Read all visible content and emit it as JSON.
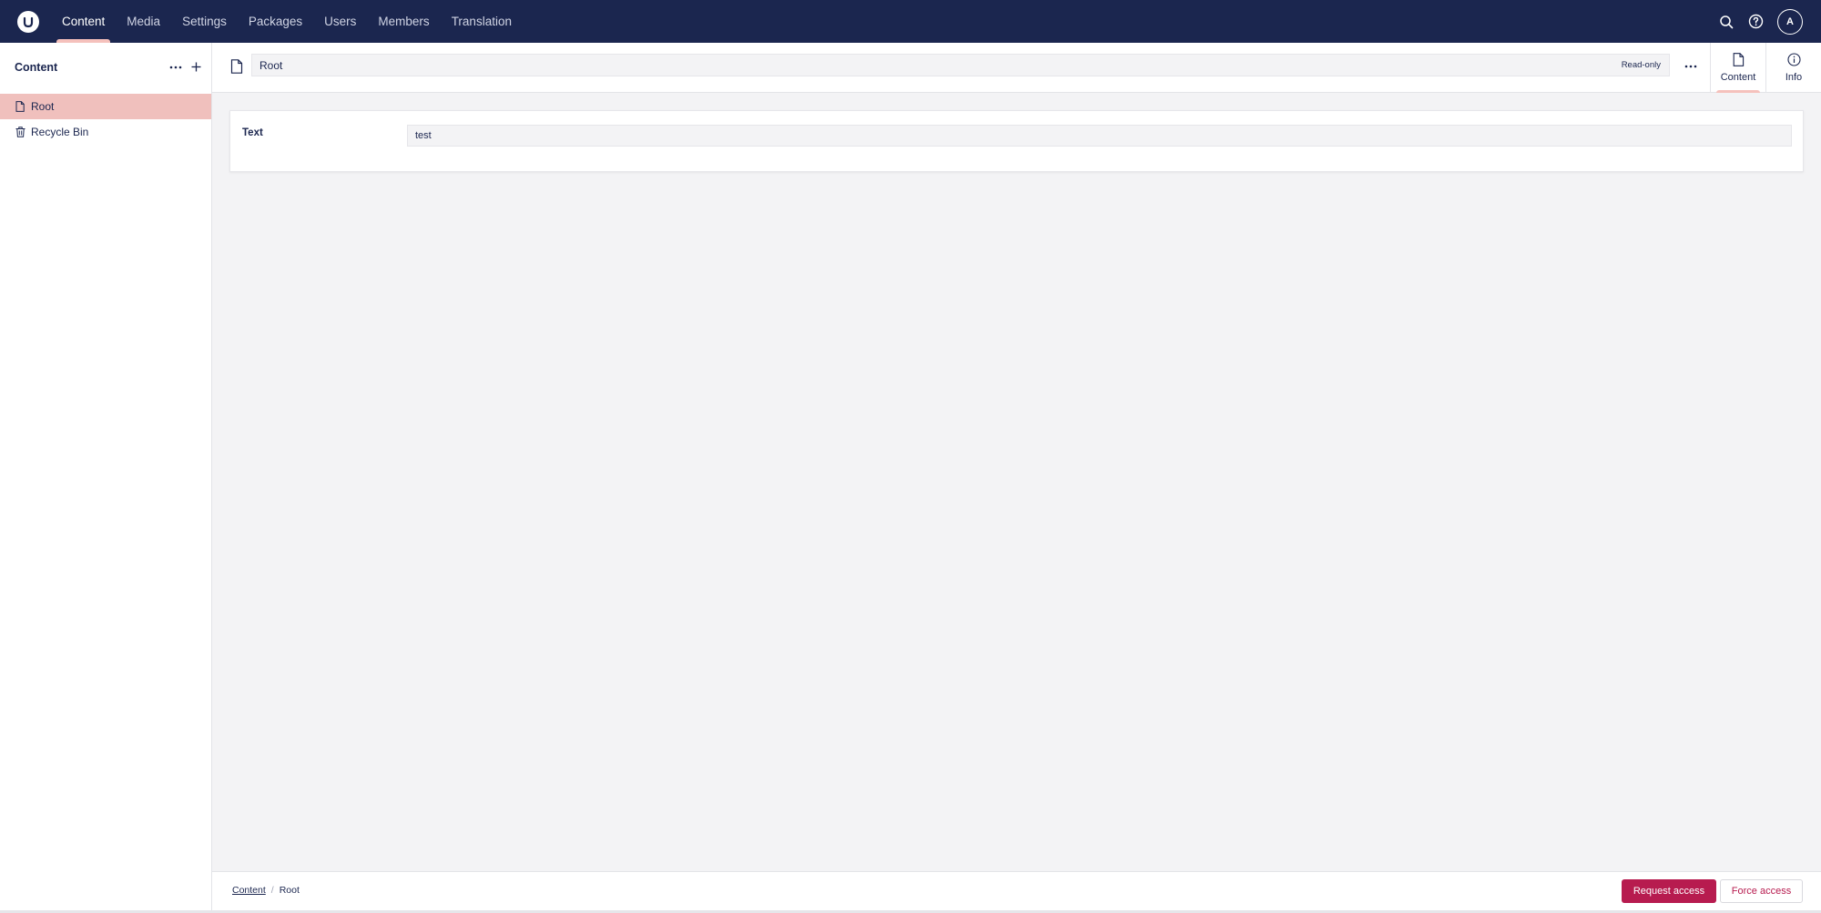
{
  "header": {
    "sections": [
      {
        "label": "Content"
      },
      {
        "label": "Media"
      },
      {
        "label": "Settings"
      },
      {
        "label": "Packages"
      },
      {
        "label": "Users"
      },
      {
        "label": "Members"
      },
      {
        "label": "Translation"
      }
    ],
    "active_section": "Content",
    "search_icon": "search-icon",
    "help_icon": "help-icon",
    "avatar_initial": "A"
  },
  "sidebar": {
    "title": "Content",
    "items": [
      {
        "label": "Root",
        "icon": "document-icon",
        "selected": true
      },
      {
        "label": "Recycle Bin",
        "icon": "trash-icon",
        "selected": false
      }
    ]
  },
  "editor": {
    "node_name": "Root",
    "status_badge": "Read-only",
    "views": [
      {
        "label": "Content",
        "icon": "document-icon",
        "active": true
      },
      {
        "label": "Info",
        "icon": "info-icon",
        "active": false
      }
    ],
    "properties": [
      {
        "label": "Text",
        "value": "test"
      }
    ]
  },
  "footer": {
    "breadcrumb": [
      {
        "label": "Content"
      },
      {
        "label": "Root"
      }
    ],
    "request_access_label": "Request access",
    "force_access_label": "Force access"
  },
  "colors": {
    "header_bg": "#1b264f",
    "accent": "#f5c1bc",
    "selected_bg": "#f0c0bd",
    "primary_button": "#b71b4f",
    "canvas_bg": "#f3f3f5"
  }
}
